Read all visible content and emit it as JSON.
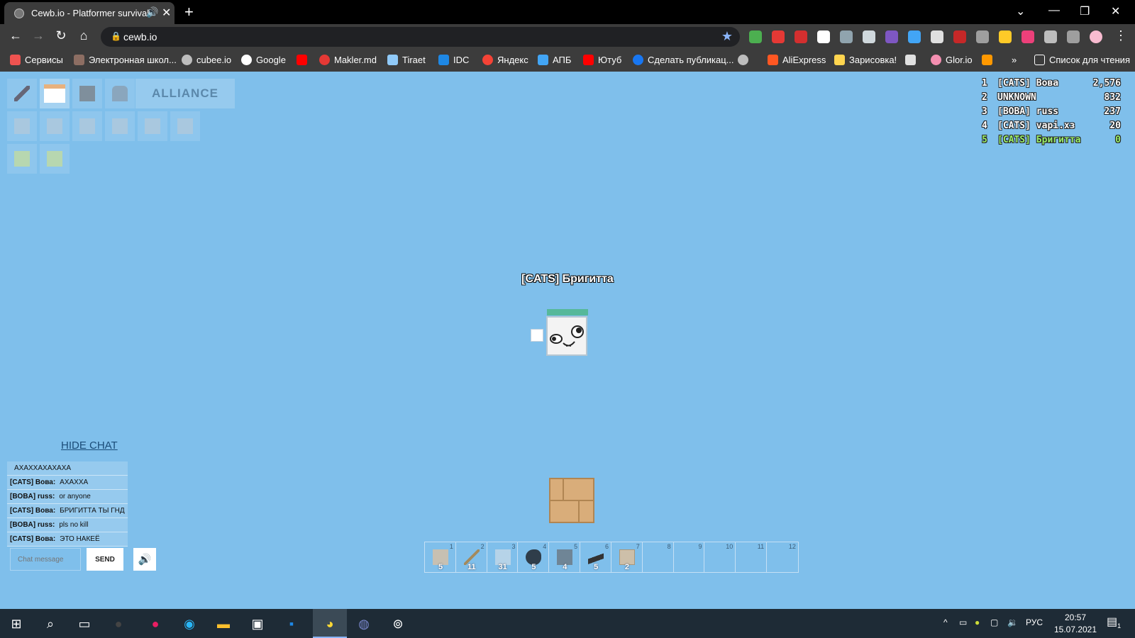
{
  "browser": {
    "tab_title": "Cewb.io - Platformer survival",
    "url": "cewb.io",
    "bookmarks": [
      "Сервисы",
      "Электронная школ...",
      "cubee.io",
      "Google",
      "",
      "Makler.md",
      "Tiraet",
      "IDC",
      "Яндекс",
      "АПБ",
      "Ютуб",
      "Сделать публикац...",
      "",
      "AliExpress",
      "Зарисовка!",
      "",
      "Glor.io",
      "",
      "»",
      "Список для чтения"
    ]
  },
  "game": {
    "alliance_label": "ALLIANCE",
    "player_name": "[CATS] Бригитта",
    "leaderboard": [
      {
        "rank": "1",
        "name": "[CATS] Вова",
        "score": "2,576"
      },
      {
        "rank": "2",
        "name": "UNKNOWN",
        "score": "832"
      },
      {
        "rank": "3",
        "name": "[BOBA] russ",
        "score": "237"
      },
      {
        "rank": "4",
        "name": "[CATS] vapi.xз",
        "score": "20"
      },
      {
        "rank": "5",
        "name": "[CATS] Бригитта",
        "score": "0"
      }
    ],
    "chat": {
      "toggle_label": "HIDE CHAT",
      "messages": [
        {
          "author": "",
          "text": "АХАХХАХАХАХА"
        },
        {
          "author": "[CATS] Вова:",
          "text": "АХАХХА"
        },
        {
          "author": "[BOBA] russ:",
          "text": "or anyone"
        },
        {
          "author": "[CATS] Вова:",
          "text": "БРИГИТТА ТЫ ГНД"
        },
        {
          "author": "[BOBA] russ:",
          "text": "pls no kill"
        },
        {
          "author": "[CATS] Вова:",
          "text": "ЭТО НАКЕЁ"
        }
      ],
      "input_placeholder": "Chat message",
      "send_label": "SEND"
    },
    "hotbar": [
      {
        "num": "1",
        "count": "5",
        "item": "stone-block"
      },
      {
        "num": "2",
        "count": "11",
        "item": "stick"
      },
      {
        "num": "3",
        "count": "31",
        "item": "glass-block"
      },
      {
        "num": "4",
        "count": "5",
        "item": "coal"
      },
      {
        "num": "5",
        "count": "4",
        "item": "steel-block"
      },
      {
        "num": "6",
        "count": "5",
        "item": "pistol"
      },
      {
        "num": "7",
        "count": "2",
        "item": "planks"
      },
      {
        "num": "8",
        "count": "",
        "item": ""
      },
      {
        "num": "9",
        "count": "",
        "item": ""
      },
      {
        "num": "10",
        "count": "",
        "item": ""
      },
      {
        "num": "11",
        "count": "",
        "item": ""
      },
      {
        "num": "12",
        "count": "",
        "item": ""
      }
    ]
  },
  "taskbar": {
    "lang": "РУС",
    "time": "20:57",
    "date": "15.07.2021",
    "notifications": "1"
  }
}
